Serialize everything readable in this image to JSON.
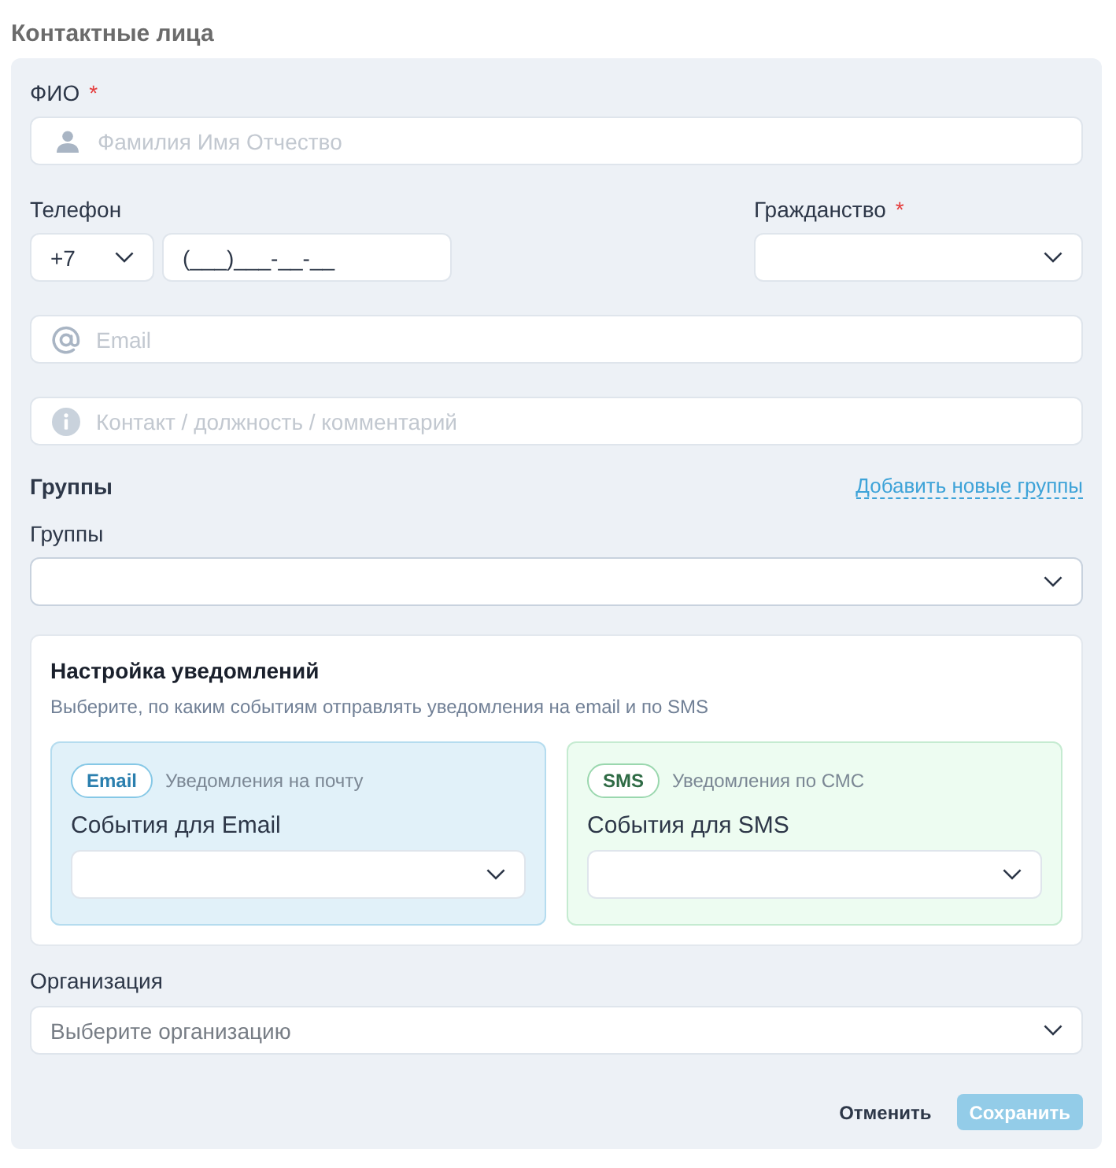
{
  "section_title": "Контактные лица",
  "full_name": {
    "label": "ФИО",
    "required_mark": "*",
    "placeholder": "Фамилия Имя Отчество"
  },
  "phone": {
    "label": "Телефон",
    "code": "+7",
    "value": "(___)___-__-__"
  },
  "citizenship": {
    "label": "Гражданство",
    "required_mark": "*"
  },
  "email": {
    "placeholder": "Email"
  },
  "contact_note": {
    "placeholder": "Контакт / должность / комментарий"
  },
  "groups": {
    "title": "Группы",
    "add_link": "Добавить новые группы",
    "label": "Группы"
  },
  "notifications": {
    "title": "Настройка уведомлений",
    "description": "Выберите, по каким событиям отправлять уведомления на email и по SMS",
    "channels": [
      {
        "kind": "email",
        "badge": "Email",
        "caption": "Уведомления на почту",
        "label": "События для Email"
      },
      {
        "kind": "sms",
        "badge": "SMS",
        "caption": "Уведомления по СМС",
        "label": "События для SMS"
      }
    ]
  },
  "organization": {
    "label": "Организация",
    "placeholder": "Выберите организацию"
  },
  "buttons": [
    {
      "kind": "cancel",
      "label": "Отменить",
      "disabled": false
    },
    {
      "kind": "save",
      "label": "Сохранить",
      "disabled": true
    }
  ]
}
